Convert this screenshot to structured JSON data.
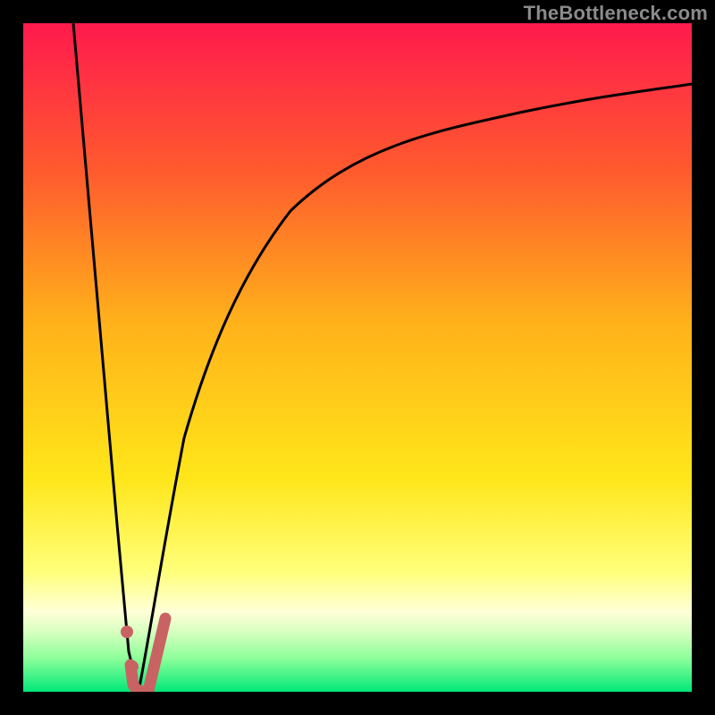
{
  "watermark": "TheBottleneck.com",
  "colors": {
    "frame": "#000000",
    "gradient_top": "#ff1a4d",
    "gradient_mid1": "#ff7d1a",
    "gradient_mid2": "#ffe61a",
    "gradient_pale": "#ffffb8",
    "gradient_bottom1": "#9dff8a",
    "gradient_bottom2": "#00e878",
    "curve": "#000000",
    "marker_stroke": "#c96363",
    "marker_fill": "#c96363"
  },
  "chart_data": {
    "type": "line",
    "title": "",
    "xlabel": "",
    "ylabel": "",
    "xlim": [
      0,
      100
    ],
    "ylim": [
      0,
      100
    ],
    "series": [
      {
        "name": "left-branch",
        "x": [
          7.5,
          14.0,
          15.8,
          17.2
        ],
        "y": [
          100,
          25,
          6,
          0
        ]
      },
      {
        "name": "right-branch",
        "x": [
          17.2,
          19.0,
          21.0,
          24.0,
          28.0,
          33.0,
          40.0,
          50.0,
          62.0,
          78.0,
          100.0
        ],
        "y": [
          0,
          9,
          22,
          38,
          52,
          63,
          72,
          79,
          84,
          88,
          91
        ]
      }
    ],
    "markers": [
      {
        "name": "marker-dot-upper",
        "x": 15.5,
        "y": 9.0
      },
      {
        "name": "marker-dot-lower",
        "x": 16.3,
        "y": 3.8
      },
      {
        "name": "marker-hook-bottom",
        "x_start": 16.0,
        "x_end": 21.2,
        "y_bottom": 0.0,
        "y_end": 11.0
      }
    ],
    "legend": []
  }
}
